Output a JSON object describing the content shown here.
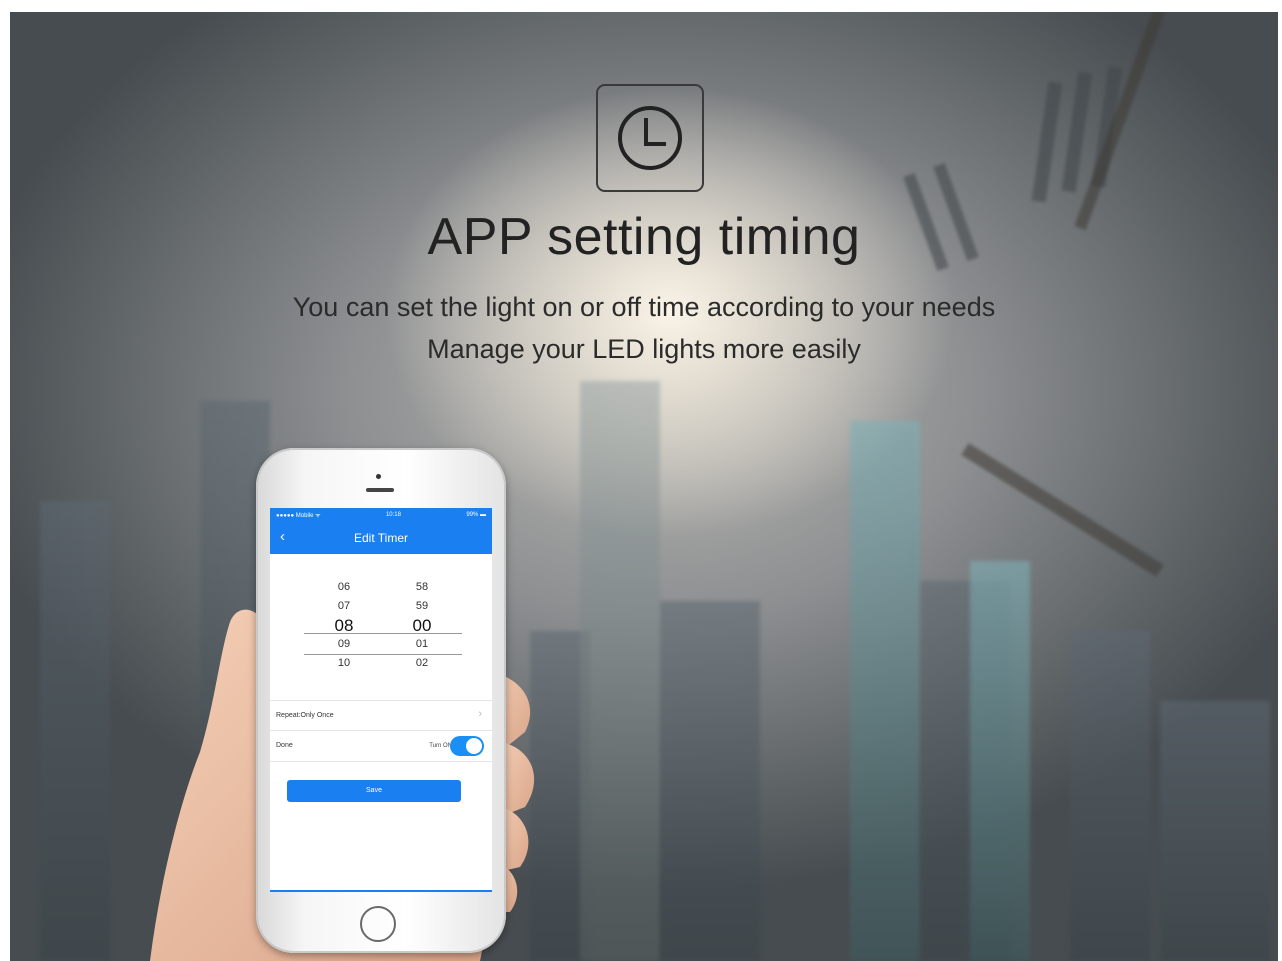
{
  "heading": {
    "title": "APP setting timing",
    "line1": "You can set the light on or off time according to your needs",
    "line2": "Manage your LED lights more easily",
    "icon": "clock-icon"
  },
  "phone": {
    "status": {
      "carrier": "●●●●● Mobile ᯤ",
      "time": "10:18",
      "battery": "99% ▬"
    },
    "nav": {
      "back": "‹",
      "title": "Edit Timer"
    },
    "picker": {
      "hours": [
        "06",
        "07",
        "08",
        "09",
        "10"
      ],
      "minutes": [
        "58",
        "59",
        "00",
        "01",
        "02"
      ],
      "selected_hour": "08",
      "selected_minute": "00"
    },
    "repeat_label": "Repeat:Only Once",
    "repeat_chevron": "›",
    "done_label": "Done",
    "toggle_label": "Turn ON",
    "toggle_on": true,
    "save_label": "Save",
    "accent": "#1a7ff0"
  }
}
